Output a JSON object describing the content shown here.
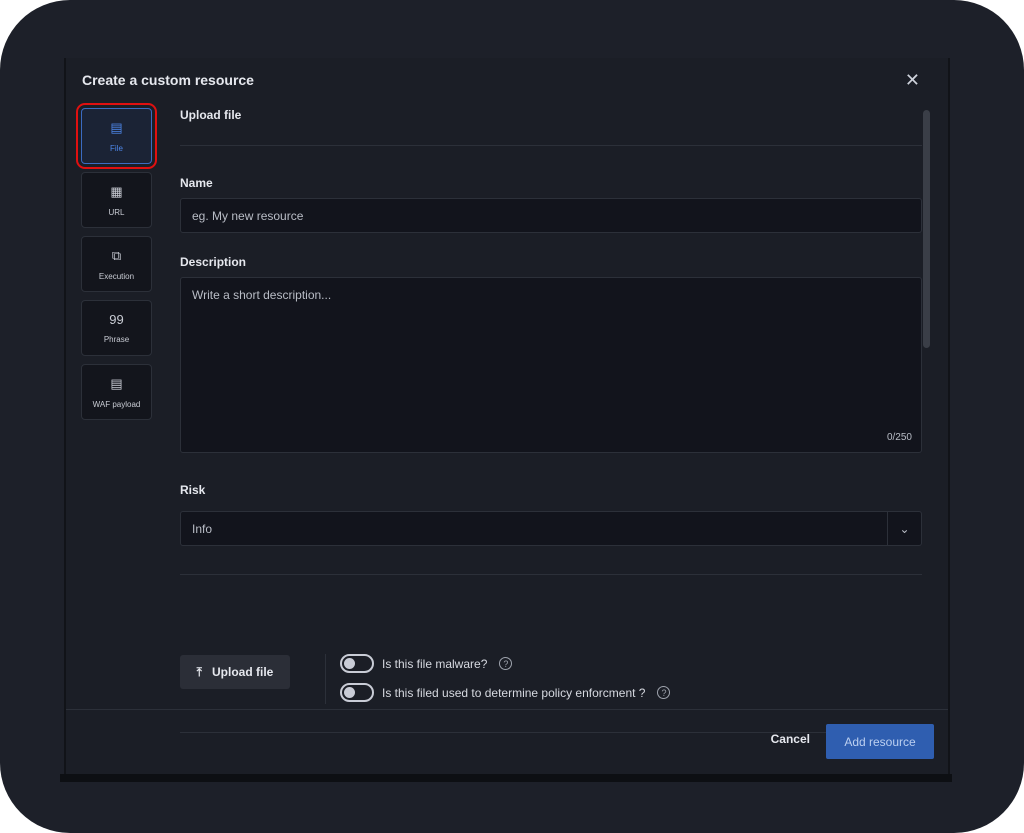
{
  "dialog": {
    "title": "Create a custom resource",
    "close_icon": "close-icon"
  },
  "types": [
    {
      "label": "File",
      "icon": "file-icon",
      "active": true
    },
    {
      "label": "URL",
      "icon": "url-icon"
    },
    {
      "label": "Execution",
      "icon": "execution-icon"
    },
    {
      "label": "Phrase",
      "icon": "quote-icon"
    },
    {
      "label": "WAF payload",
      "icon": "waf-payload-icon"
    }
  ],
  "form": {
    "section": "Upload file",
    "name_label": "Name",
    "name_placeholder": "eg. My new resource",
    "desc_label": "Description",
    "desc_placeholder": "Write a short description...",
    "desc_count": "0/250",
    "risk_label": "Risk",
    "risk_value": "Info",
    "upload_label": "Upload file",
    "malware_label": "Is this file malware?",
    "policy_label": "Is this filed used to determine policy enforcment ?"
  },
  "footer": {
    "cancel": "Cancel",
    "add": "Add resource"
  },
  "colors": {
    "accent": "#2f5eb0",
    "highlight": "#e01010"
  }
}
